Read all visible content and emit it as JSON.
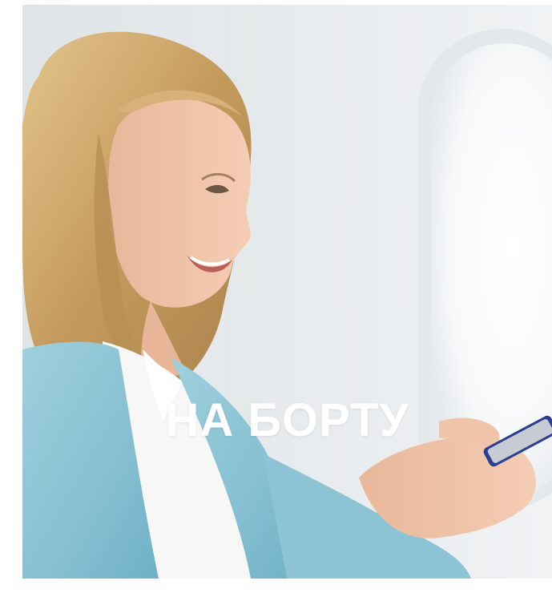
{
  "hero": {
    "title": "НА БОРТУ",
    "image": "woman-smiling-at-phone-by-airplane-window"
  },
  "colors": {
    "title": "#ffffff",
    "cardigan": "#8fc3d4",
    "hair": "#c9a36a",
    "cabin_wall": "#eceff1",
    "phone": "#2c3e8f"
  }
}
